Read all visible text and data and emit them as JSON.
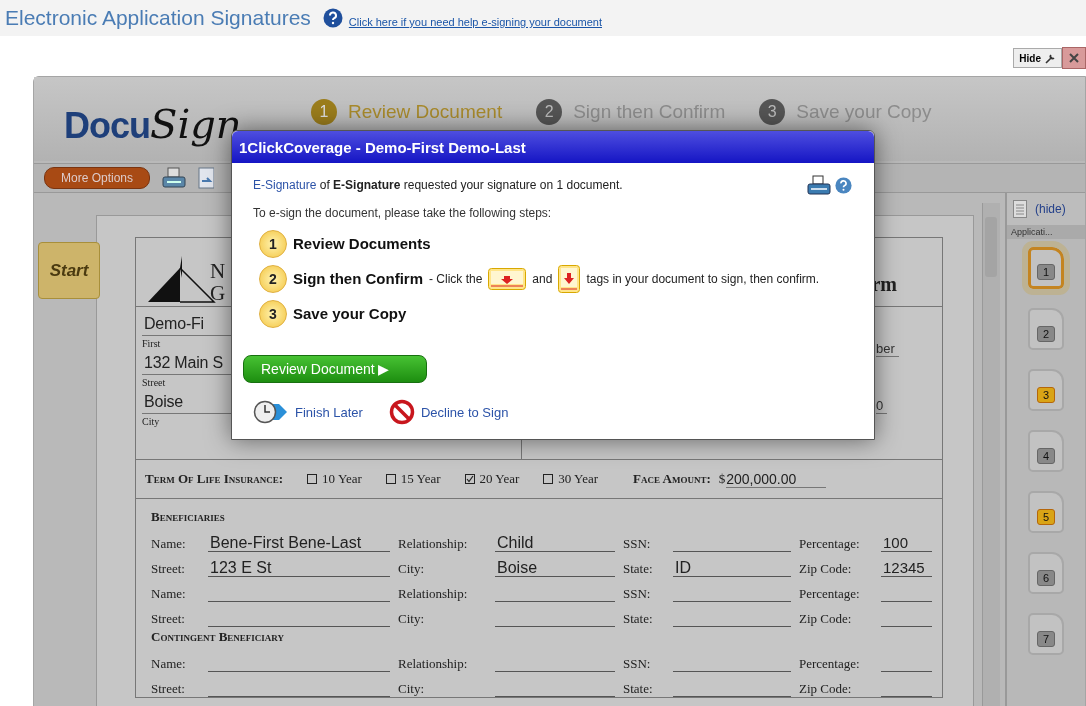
{
  "header": {
    "title": "Electronic Application Signatures",
    "help_link": "Click here if you need help e-signing your document"
  },
  "hide_button": "Hide",
  "docusign": {
    "logo_first": "Docu",
    "logo_second": "Sign",
    "steps": [
      {
        "number": "1",
        "label": "Review Document",
        "selected": true
      },
      {
        "number": "2",
        "label": "Sign then Confirm",
        "selected": false
      },
      {
        "number": "3",
        "label": "Save your Copy",
        "selected": false
      }
    ],
    "more_options": "More Options",
    "start_tab": "Start"
  },
  "document": {
    "company_initials": [
      "N",
      "G"
    ],
    "heading_fragment": "rm",
    "top_fields": [
      {
        "value": "Demo-Fi",
        "label": "First"
      },
      {
        "value": "132 Main S",
        "label": "Street"
      },
      {
        "value": "Boise",
        "label": "City"
      }
    ],
    "right_fragments": [
      "ber",
      "0"
    ],
    "term": {
      "label": "Term Of Life Insurance:",
      "options": [
        {
          "label": "10 Year",
          "checked": false
        },
        {
          "label": "15 Year",
          "checked": false
        },
        {
          "label": "20 Year",
          "checked": true
        },
        {
          "label": "30 Year",
          "checked": false
        }
      ],
      "face_label": "Face Amount:",
      "currency": "$",
      "face_value": "200,000.00"
    },
    "sections": [
      {
        "heading": "Beneficiaries",
        "rows": [
          [
            {
              "label": "Name:",
              "value": "Bene-First Bene-Last"
            },
            {
              "label": "Relationship:",
              "value": "Child"
            },
            {
              "label": "SSN:"
            },
            {
              "label": "Percentage:",
              "value": "100"
            }
          ],
          [
            {
              "label": "Street:",
              "value": "123 E St"
            },
            {
              "label": "City:",
              "value": "Boise"
            },
            {
              "label": "State:",
              "value": "ID"
            },
            {
              "label": "Zip Code:",
              "value": "12345"
            }
          ],
          [
            {
              "label": "Name:"
            },
            {
              "label": "Relationship:"
            },
            {
              "label": "SSN:"
            },
            {
              "label": "Percentage:"
            }
          ],
          [
            {
              "label": "Street:"
            },
            {
              "label": "City:"
            },
            {
              "label": "State:"
            },
            {
              "label": "Zip Code:"
            }
          ]
        ]
      },
      {
        "heading": "Contingent Beneficiary",
        "rows": [
          [
            {
              "label": "Name:"
            },
            {
              "label": "Relationship:"
            },
            {
              "label": "SSN:"
            },
            {
              "label": "Percentage:"
            }
          ],
          [
            {
              "label": "Street:"
            },
            {
              "label": "City:"
            },
            {
              "label": "State:"
            },
            {
              "label": "Zip Code:"
            }
          ]
        ]
      }
    ]
  },
  "sidebar": {
    "hide_link": "(hide)",
    "section": "Applicati...",
    "pages": [
      {
        "number": "1",
        "selected": true,
        "flagged": false
      },
      {
        "number": "2",
        "selected": false,
        "flagged": false
      },
      {
        "number": "3",
        "selected": false,
        "flagged": true
      },
      {
        "number": "4",
        "selected": false,
        "flagged": false
      },
      {
        "number": "5",
        "selected": false,
        "flagged": true
      },
      {
        "number": "6",
        "selected": false,
        "flagged": false
      },
      {
        "number": "7",
        "selected": false,
        "flagged": false
      }
    ]
  },
  "dialog": {
    "title": "1ClickCoverage - Demo-First Demo-Last",
    "sender_link": "E-Signature",
    "intro": " of **E-Signature** requested your signature on 1 document.",
    "instruction": "To e-sign the document, please take the following steps:",
    "steps": [
      {
        "number": "1",
        "title": "Review Documents"
      },
      {
        "number": "2",
        "title": "Sign then Confirm",
        "detail": [
          "- Click the",
          "and",
          "tags in your document to sign, then confirm."
        ]
      },
      {
        "number": "3",
        "title": "Save your Copy"
      }
    ],
    "primary_button": "Review Document ▶",
    "finish_later": "Finish Later",
    "decline": "Decline to Sign"
  }
}
